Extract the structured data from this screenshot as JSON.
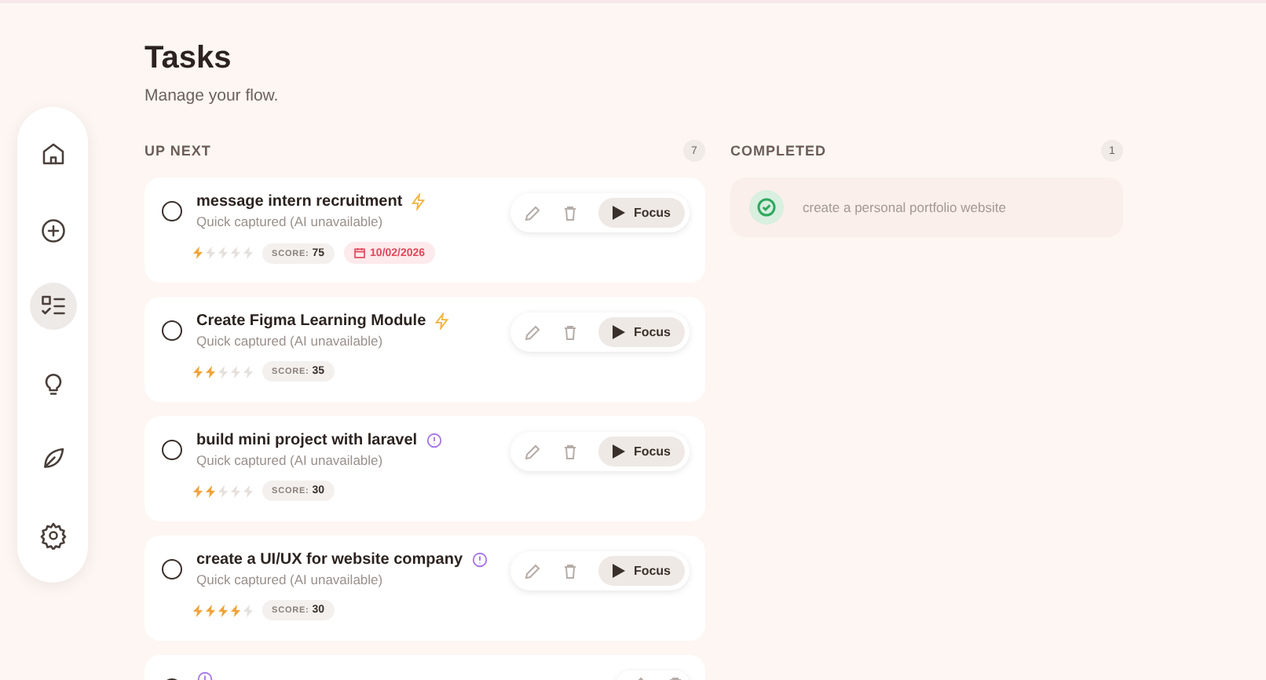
{
  "sidebar": {
    "items": [
      {
        "selected": false
      },
      {
        "selected": false
      },
      {
        "selected": true
      },
      {
        "selected": false
      },
      {
        "selected": false
      },
      {
        "selected": false
      }
    ]
  },
  "header": {
    "title": "Tasks",
    "subtitle": "Manage your flow."
  },
  "up_next": {
    "heading": "UP NEXT",
    "count": "7",
    "tasks": [
      {
        "title": "message intern recruitment",
        "checked": false,
        "kind": "bolt",
        "subtitle": "Quick captured (AI unavailable)",
        "stars": 1,
        "score_label": "SCORE:",
        "score": "75",
        "due": "10/02/2026",
        "focus": "Focus"
      },
      {
        "title": "Create Figma Learning Module",
        "checked": false,
        "kind": "bolt",
        "subtitle": "Quick captured (AI unavailable)",
        "stars": 2,
        "score_label": "SCORE:",
        "score": "35",
        "focus": "Focus"
      },
      {
        "title": "build mini project with laravel",
        "checked": false,
        "kind": "info",
        "subtitle": "Quick captured (AI unavailable)",
        "stars": 2,
        "score_label": "SCORE:",
        "score": "30",
        "focus": "Focus"
      },
      {
        "title": "create a UI/UX for website company",
        "checked": false,
        "kind": "info",
        "subtitle": "Quick captured (AI unavailable)",
        "stars": 4,
        "score_label": "SCORE:",
        "score": "30",
        "focus": "Focus"
      },
      {
        "checked": false,
        "kind": "info"
      }
    ]
  },
  "completed": {
    "heading": "COMPLETED",
    "count": "1",
    "tasks": [
      {
        "title": "create a personal portfolio website"
      }
    ]
  }
}
